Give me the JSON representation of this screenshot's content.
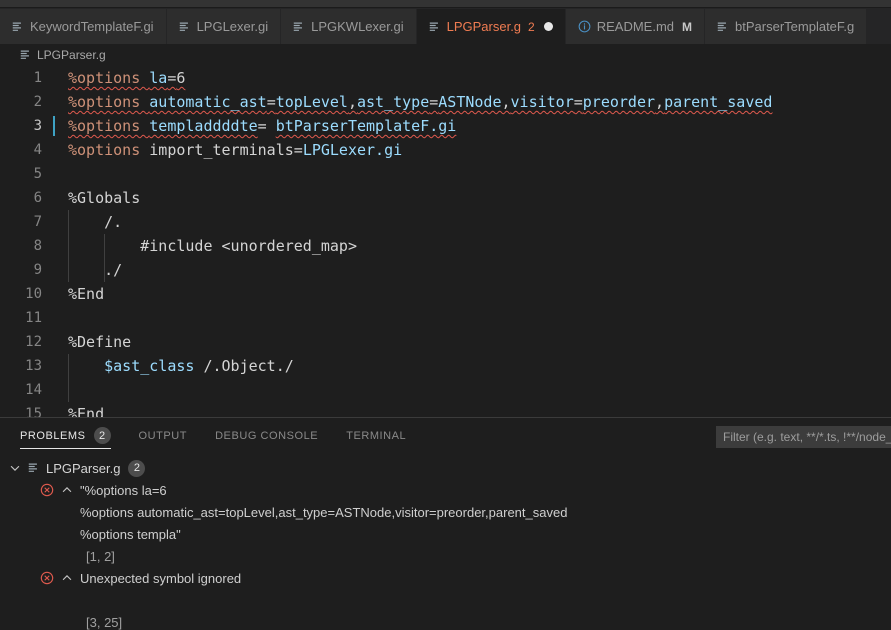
{
  "tabs": [
    {
      "label": "KeywordTemplateF.gi",
      "icon": "file-icon",
      "active": false,
      "dirty": false,
      "error_count": "",
      "modified_flag": ""
    },
    {
      "label": "LPGLexer.gi",
      "icon": "file-icon",
      "active": false,
      "dirty": false,
      "error_count": "",
      "modified_flag": ""
    },
    {
      "label": "LPGKWLexer.gi",
      "icon": "file-icon",
      "active": false,
      "dirty": false,
      "error_count": "",
      "modified_flag": ""
    },
    {
      "label": "LPGParser.g",
      "icon": "file-icon",
      "active": true,
      "dirty": true,
      "error_count": "2",
      "modified_flag": ""
    },
    {
      "label": "README.md",
      "icon": "info-icon",
      "active": false,
      "dirty": false,
      "error_count": "",
      "modified_flag": "M"
    },
    {
      "label": "btParserTemplateF.g",
      "icon": "file-icon",
      "active": false,
      "dirty": false,
      "error_count": "",
      "modified_flag": ""
    }
  ],
  "breadcrumb": {
    "icon": "file-icon",
    "label": "LPGParser.g"
  },
  "editor": {
    "lines": [
      {
        "num": "1",
        "cursor": false,
        "indents": 0,
        "segments": [
          {
            "t": "%options ",
            "c": "tok-dir",
            "squiggle": true
          },
          {
            "t": "la",
            "c": "tok-key",
            "squiggle": true
          },
          {
            "t": "=",
            "c": "tok-plain",
            "squiggle": true
          },
          {
            "t": "6",
            "c": "tok-plain",
            "squiggle": true
          }
        ]
      },
      {
        "num": "2",
        "cursor": false,
        "indents": 0,
        "segments": [
          {
            "t": "%options ",
            "c": "tok-dir",
            "squiggle": true
          },
          {
            "t": "automatic_ast",
            "c": "tok-key",
            "squiggle": true
          },
          {
            "t": "=",
            "c": "tok-plain",
            "squiggle": true
          },
          {
            "t": "topLevel",
            "c": "tok-key",
            "squiggle": true
          },
          {
            "t": ",",
            "c": "tok-plain",
            "squiggle": true
          },
          {
            "t": "ast_type",
            "c": "tok-key",
            "squiggle": true
          },
          {
            "t": "=",
            "c": "tok-plain",
            "squiggle": true
          },
          {
            "t": "ASTNode",
            "c": "tok-key",
            "squiggle": true
          },
          {
            "t": ",",
            "c": "tok-plain",
            "squiggle": true
          },
          {
            "t": "visitor",
            "c": "tok-key",
            "squiggle": true
          },
          {
            "t": "=",
            "c": "tok-plain",
            "squiggle": true
          },
          {
            "t": "preorder",
            "c": "tok-key",
            "squiggle": true
          },
          {
            "t": ",",
            "c": "tok-plain",
            "squiggle": true
          },
          {
            "t": "parent_saved",
            "c": "tok-key",
            "squiggle": true
          }
        ]
      },
      {
        "num": "3",
        "cursor": true,
        "indents": 0,
        "segments": [
          {
            "t": "%options ",
            "c": "tok-dir",
            "squiggle": true
          },
          {
            "t": "templaddddte",
            "c": "tok-key",
            "squiggle": true
          },
          {
            "t": "= ",
            "c": "tok-plain",
            "squiggle": false
          },
          {
            "t": "btParserTemplateF.gi",
            "c": "tok-key",
            "squiggle": true
          }
        ]
      },
      {
        "num": "4",
        "cursor": false,
        "indents": 0,
        "segments": [
          {
            "t": "%options ",
            "c": "tok-dir",
            "squiggle": false
          },
          {
            "t": "import_terminals",
            "c": "tok-plain",
            "squiggle": false
          },
          {
            "t": "=",
            "c": "tok-plain",
            "squiggle": false
          },
          {
            "t": "LPGLexer.gi",
            "c": "tok-key",
            "squiggle": false
          }
        ]
      },
      {
        "num": "5",
        "cursor": false,
        "indents": 0,
        "segments": []
      },
      {
        "num": "6",
        "cursor": false,
        "indents": 0,
        "segments": [
          {
            "t": "%Globals",
            "c": "tok-plain",
            "squiggle": false
          }
        ]
      },
      {
        "num": "7",
        "cursor": false,
        "indents": 1,
        "segments": [
          {
            "t": "    /.",
            "c": "tok-plain",
            "squiggle": false
          }
        ]
      },
      {
        "num": "8",
        "cursor": false,
        "indents": 2,
        "segments": [
          {
            "t": "        #include <unordered_map>",
            "c": "tok-plain",
            "squiggle": false
          }
        ]
      },
      {
        "num": "9",
        "cursor": false,
        "indents": 2,
        "segments": [
          {
            "t": "    ./",
            "c": "tok-plain",
            "squiggle": false
          }
        ]
      },
      {
        "num": "10",
        "cursor": false,
        "indents": 0,
        "segments": [
          {
            "t": "%End",
            "c": "tok-plain",
            "squiggle": false
          }
        ]
      },
      {
        "num": "11",
        "cursor": false,
        "indents": 0,
        "segments": []
      },
      {
        "num": "12",
        "cursor": false,
        "indents": 0,
        "segments": [
          {
            "t": "%Define",
            "c": "tok-plain",
            "squiggle": false
          }
        ]
      },
      {
        "num": "13",
        "cursor": false,
        "indents": 1,
        "segments": [
          {
            "t": "    ",
            "c": "tok-plain",
            "squiggle": false
          },
          {
            "t": "$ast_class",
            "c": "tok-var",
            "squiggle": false
          },
          {
            "t": " /.Object./",
            "c": "tok-plain",
            "squiggle": false
          }
        ]
      },
      {
        "num": "14",
        "cursor": false,
        "indents": 1,
        "segments": []
      },
      {
        "num": "15",
        "cursor": false,
        "indents": 0,
        "segments": [
          {
            "t": "%End",
            "c": "tok-plain",
            "squiggle": false
          }
        ]
      }
    ]
  },
  "panel": {
    "tabs": [
      {
        "label": "PROBLEMS",
        "badge": "2",
        "active": true
      },
      {
        "label": "OUTPUT",
        "badge": "",
        "active": false
      },
      {
        "label": "DEBUG CONSOLE",
        "badge": "",
        "active": false
      },
      {
        "label": "TERMINAL",
        "badge": "",
        "active": false
      }
    ],
    "filter": {
      "placeholder": "Filter (e.g. text, **/*.ts, !**/node_modules/**)",
      "value": ""
    },
    "problems": {
      "file_name": "LPGParser.g",
      "file_count": "2",
      "file_expanded_icon": "chevron-down-icon",
      "items": [
        {
          "severity_icon": "error-icon",
          "toggle_icon": "chevron-up-icon",
          "message_lines": [
            "\"%options la=6",
            "%options automatic_ast=topLevel,ast_type=ASTNode,visitor=preorder,parent_saved",
            "%options templa\""
          ],
          "location": "[1, 2]"
        },
        {
          "severity_icon": "error-icon",
          "toggle_icon": "chevron-up-icon",
          "message_lines": [
            "Unexpected symbol ignored",
            ""
          ],
          "location": "[3, 25]"
        }
      ]
    }
  },
  "colors": {
    "editor_bg": "#1e1e1e",
    "tabbar_bg": "#252526",
    "tab_inactive_bg": "#2d2d2d",
    "accent_error": "#f07c52",
    "error_red": "#e05a4e",
    "keyword_blue": "#9cdcfe",
    "directive_orange": "#ce9178",
    "cursor_blue": "#3ea2c4"
  }
}
